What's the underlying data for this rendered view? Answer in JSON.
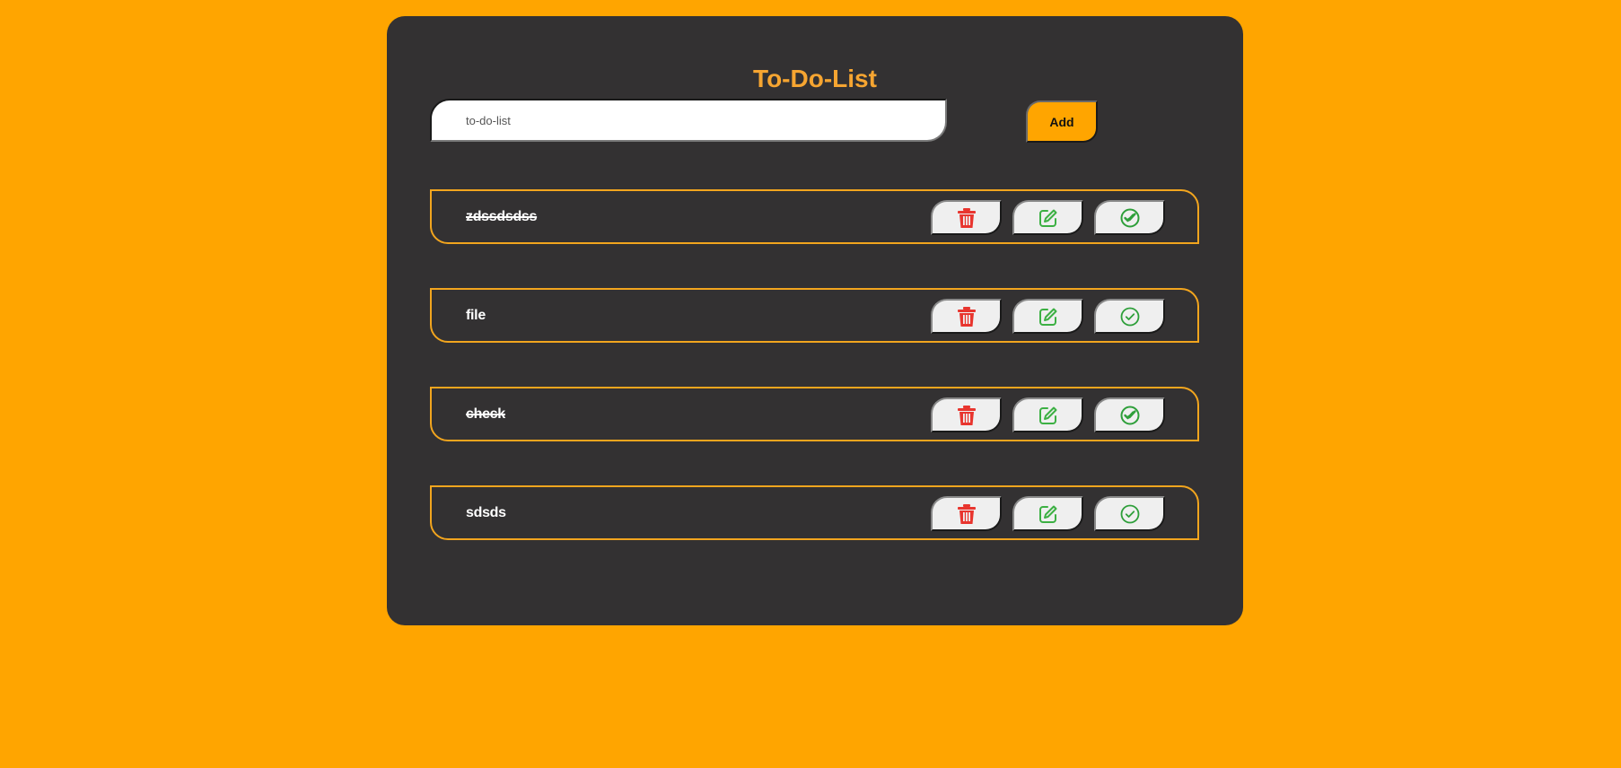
{
  "app": {
    "title": "To-Do-List"
  },
  "input": {
    "value": "",
    "placeholder": "to-do-list"
  },
  "add_button": {
    "label": "Add"
  },
  "colors": {
    "background": "#ffa500",
    "card": "#333132",
    "accent": "#f6a531",
    "delete_icon": "#e8352e",
    "edit_icon": "#3cb043",
    "complete_icon": "#2e9f3a"
  },
  "tasks": [
    {
      "text": "zdssdsdss",
      "completed": true,
      "icons": [
        "trash-icon",
        "edit-icon",
        "check-double-icon"
      ]
    },
    {
      "text": "file",
      "completed": false,
      "icons": [
        "trash-icon",
        "edit-icon",
        "check-circle-icon"
      ]
    },
    {
      "text": "check",
      "completed": true,
      "icons": [
        "trash-icon",
        "edit-icon",
        "check-double-icon"
      ]
    },
    {
      "text": "sdsds",
      "completed": false,
      "icons": [
        "trash-icon",
        "edit-icon",
        "check-circle-icon"
      ]
    }
  ]
}
